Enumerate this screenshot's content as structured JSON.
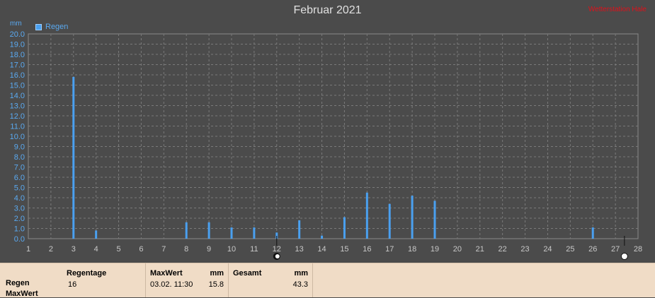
{
  "page": {
    "title": "Februar 2021",
    "watermark": "Wetterstation Hale",
    "y_unit": "mm"
  },
  "chart_data": {
    "type": "bar",
    "title": "Februar 2021",
    "xlabel": "",
    "ylabel": "mm",
    "xlim": [
      1,
      28
    ],
    "ylim": [
      0,
      20
    ],
    "grid": true,
    "legend": "top-left",
    "x_ticks": [
      1,
      2,
      3,
      4,
      5,
      6,
      7,
      8,
      9,
      10,
      11,
      12,
      13,
      14,
      15,
      16,
      17,
      18,
      19,
      20,
      21,
      22,
      23,
      24,
      25,
      26,
      27,
      28
    ],
    "y_ticks": [
      "0.0",
      "1.0",
      "2.0",
      "3.0",
      "4.0",
      "5.0",
      "6.0",
      "7.0",
      "8.0",
      "9.0",
      "10.0",
      "11.0",
      "12.0",
      "13.0",
      "14.0",
      "15.0",
      "16.0",
      "17.0",
      "18.0",
      "19.0",
      "20.0"
    ],
    "series": [
      {
        "name": "Regen",
        "color": "#4aa0f0",
        "x": [
          3,
          4,
          8,
          9,
          10,
          11,
          12,
          13,
          14,
          15,
          16,
          17,
          18,
          19,
          26
        ],
        "values": [
          15.8,
          0.8,
          1.6,
          1.6,
          1.1,
          1.1,
          0.6,
          1.8,
          0.3,
          2.1,
          4.5,
          3.4,
          4.2,
          3.7,
          1.1
        ]
      }
    ],
    "markers": [
      {
        "label": "moon-new-marker",
        "x": 12
      },
      {
        "label": "moon-full-marker",
        "x": 27.4
      }
    ]
  },
  "stats": {
    "rows": [
      "Regen",
      "MaxWert"
    ],
    "columns": [
      {
        "header": "Regentage",
        "unit": "",
        "value": "16",
        "value2": ""
      },
      {
        "header": "MaxWert",
        "unit": "mm",
        "value": "03.02.  11:30",
        "value2": "15.8"
      },
      {
        "header": "Gesamt",
        "unit": "mm",
        "value": "",
        "value2": "43.3"
      }
    ]
  }
}
